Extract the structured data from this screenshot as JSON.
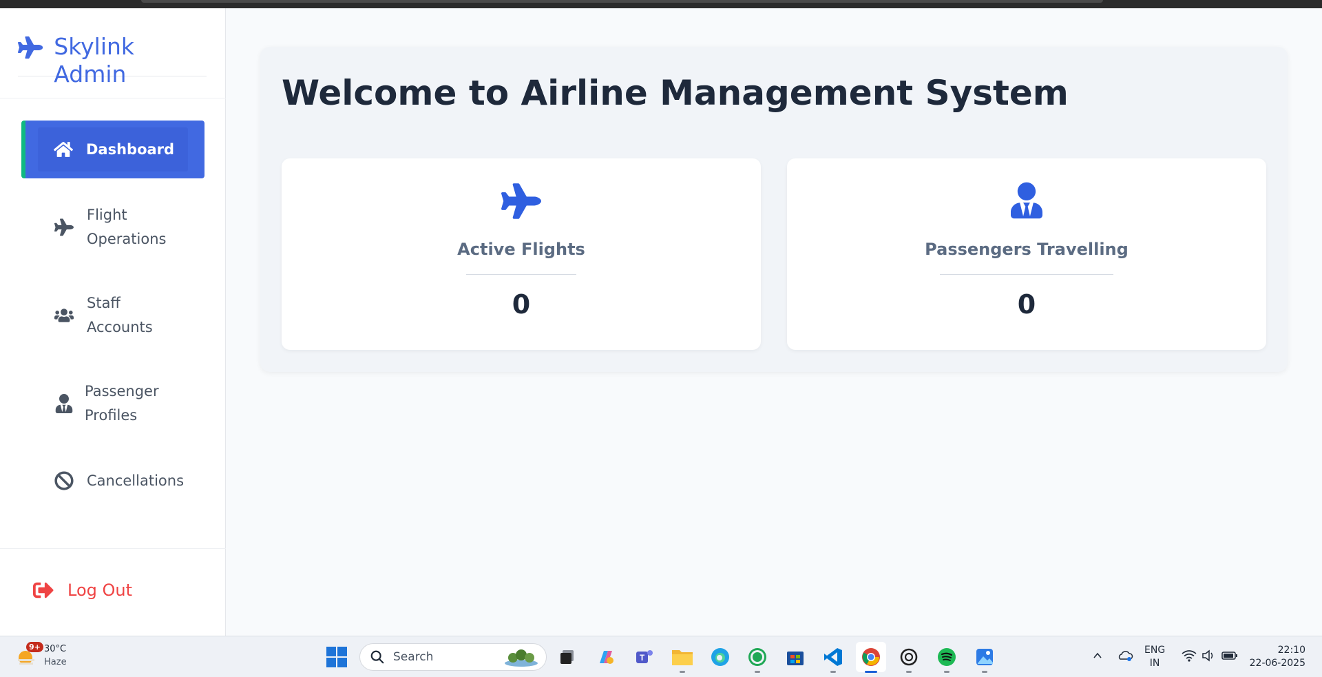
{
  "brand": {
    "title": "Skylink Admin",
    "icon": "plane-icon"
  },
  "sidebar": {
    "items": [
      {
        "label": "Dashboard",
        "icon": "home-icon",
        "active": true
      },
      {
        "label": "Flight Operations",
        "icon": "plane-icon",
        "active": false
      },
      {
        "label": "Staff Accounts",
        "icon": "users-icon",
        "active": false
      },
      {
        "label": "Passenger Profiles",
        "icon": "user-tie-icon",
        "active": false
      },
      {
        "label": "Cancellations",
        "icon": "ban-icon",
        "active": false
      }
    ],
    "logout_label": "Log Out"
  },
  "main": {
    "title": "Welcome to Airline Management System",
    "cards": [
      {
        "label": "Active Flights",
        "value": "0",
        "icon": "plane-icon"
      },
      {
        "label": "Passengers Travelling",
        "value": "0",
        "icon": "user-tie-icon"
      }
    ]
  },
  "taskbar": {
    "weather": {
      "badge": "9+",
      "temp": "30°C",
      "condition": "Haze"
    },
    "search_placeholder": "Search",
    "language": {
      "line1": "ENG",
      "line2": "IN"
    },
    "clock": {
      "time": "22:10",
      "date": "22-06-2025"
    }
  },
  "colors": {
    "accent": "#4169e1",
    "active_border": "#10b981",
    "logout": "#ef4444",
    "title": "#1e293b"
  }
}
